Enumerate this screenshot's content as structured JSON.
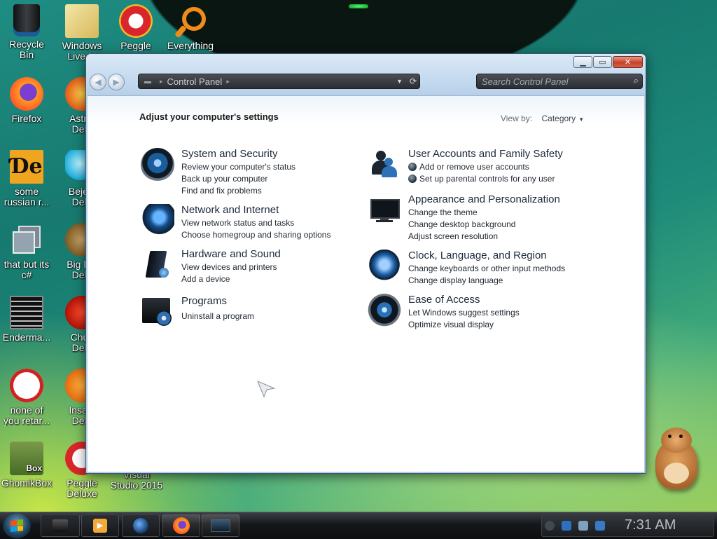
{
  "desktop": {
    "icons": [
      {
        "label_1": "Recycle",
        "label_2": "Bin",
        "icon": "recycle-bin-icon"
      },
      {
        "label_1": "Windows",
        "label_2": "Live M",
        "icon": "windows-live-mail-icon"
      },
      {
        "label_1": "Peggle",
        "label_2": "",
        "icon": "peggle-icon"
      },
      {
        "label_1": "Everything",
        "label_2": "",
        "icon": "everything-search-icon"
      },
      {
        "label_1": "Firefox",
        "label_2": "",
        "icon": "firefox-icon"
      },
      {
        "label_1": "Astrol",
        "label_2": "Delu",
        "icon": "astropop-icon"
      },
      {
        "label_1": "some",
        "label_2": "russian r...",
        "icon": "de-app-icon"
      },
      {
        "label_1": "Bejew",
        "label_2": "Delu",
        "icon": "bejeweled-icon"
      },
      {
        "label_1": "that but its",
        "label_2": "c#",
        "icon": "copy-windows-icon"
      },
      {
        "label_1": "Big Mo",
        "label_2": "Delu",
        "icon": "big-money-icon"
      },
      {
        "label_1": "Enderma...",
        "label_2": "",
        "icon": "enderman-app-icon"
      },
      {
        "label_1": "Chuz",
        "label_2": "Delu",
        "icon": "chuzzle-icon"
      },
      {
        "label_1": "none of",
        "label_2": "you retar...",
        "icon": "dino-app-icon"
      },
      {
        "label_1": "Insani",
        "label_2": "Delu",
        "icon": "insaniquarium-icon"
      },
      {
        "label_1": "GhomikBox",
        "label_2": "",
        "icon": "ghomikbox-icon"
      },
      {
        "label_1": "Peggle",
        "label_2": "Deluxe",
        "icon": "peggle-deluxe-icon"
      },
      {
        "label_1": "Visual",
        "label_2": "Studio 2015",
        "icon": "visual-studio-icon"
      }
    ],
    "ghomik_badge": "Box"
  },
  "window": {
    "address": {
      "segment": "Control Panel"
    },
    "search": {
      "placeholder": "Search Control Panel"
    },
    "heading": "Adjust your computer's settings",
    "view_by": {
      "label": "View by:",
      "value": "Category"
    },
    "categories_left": [
      {
        "title": "System and Security",
        "links": [
          "Review your computer's status",
          "Back up your computer",
          "Find and fix problems"
        ]
      },
      {
        "title": "Network and Internet",
        "links": [
          "View network status and tasks",
          "Choose homegroup and sharing options"
        ]
      },
      {
        "title": "Hardware and Sound",
        "links": [
          "View devices and printers",
          "Add a device"
        ]
      },
      {
        "title": "Programs",
        "links": [
          "Uninstall a program"
        ]
      }
    ],
    "categories_right": [
      {
        "title": "User Accounts and Family Safety",
        "links": [
          "Add or remove user accounts",
          "Set up parental controls for any user"
        ]
      },
      {
        "title": "Appearance and Personalization",
        "links": [
          "Change the theme",
          "Change desktop background",
          "Adjust screen resolution"
        ]
      },
      {
        "title": "Clock, Language, and Region",
        "links": [
          "Change keyboards or other input methods",
          "Change display language"
        ]
      },
      {
        "title": "Ease of Access",
        "links": [
          "Let Windows suggest settings",
          "Optimize visual display"
        ]
      }
    ]
  },
  "taskbar": {
    "clock": "7:31 AM"
  },
  "colors": {
    "link_text": "#222a33",
    "title_text": "#1b2a3a",
    "close_button": "#c54228"
  }
}
